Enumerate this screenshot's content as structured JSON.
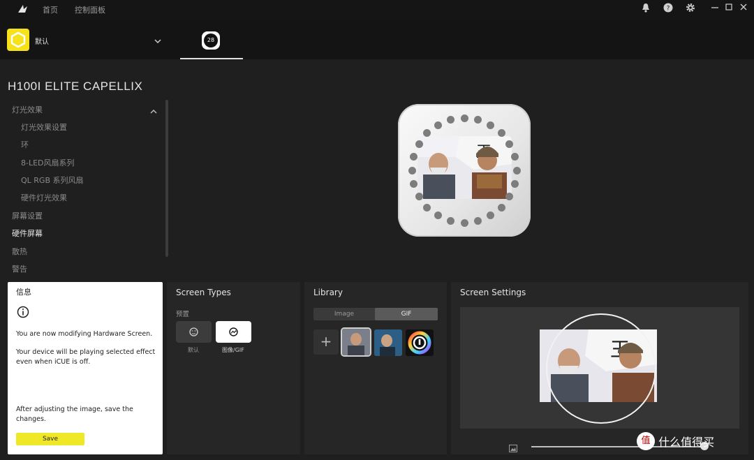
{
  "topbar": {
    "nav": [
      "首页",
      "控制面板"
    ],
    "icons": [
      "bell-icon",
      "help-icon",
      "gear-icon",
      "minimize-icon",
      "maximize-icon",
      "close-icon"
    ]
  },
  "profile": {
    "name": "默认"
  },
  "device_tab": {
    "value": "28"
  },
  "device": {
    "title": "H100I ELITE CAPELLIX"
  },
  "sidebar": {
    "items": [
      {
        "label": "灯光效果",
        "level": 0,
        "active": false,
        "expanded": true
      },
      {
        "label": "灯光效果设置",
        "level": 1
      },
      {
        "label": "环",
        "level": 1
      },
      {
        "label": "8-LED风扇系列",
        "level": 1
      },
      {
        "label": "QL RGB 系列风扇",
        "level": 1
      },
      {
        "label": "硬件灯光效果",
        "level": 1
      },
      {
        "label": "屏幕设置",
        "level": 0
      },
      {
        "label": "硬件屏幕",
        "level": 0,
        "active": true
      },
      {
        "label": "散热",
        "level": 0
      },
      {
        "label": "警告",
        "level": 0
      }
    ]
  },
  "info_panel": {
    "title": "信息",
    "line1": "You are now modifying Hardware Screen.",
    "line2": "Your device will be playing selected effect even when iCUE is off.",
    "line3": "After adjusting the image, save the changes.",
    "save_label": "Save"
  },
  "screen_types": {
    "title": "Screen Types",
    "group_label": "预置",
    "options": [
      {
        "label": "默认",
        "selected": false
      },
      {
        "label": "图像/GIF",
        "selected": true
      }
    ]
  },
  "library": {
    "title": "Library",
    "tabs": [
      {
        "label": "Image",
        "active": false
      },
      {
        "label": "GIF",
        "active": true
      }
    ],
    "add_label": "+"
  },
  "screen_settings": {
    "title": "Screen Settings",
    "zoom_fraction": 0.99
  },
  "watermark": {
    "text": "值 什么值得买"
  },
  "colors": {
    "accent": "#f5e21a",
    "save": "#efe826",
    "panel": "#262626",
    "bg": "#1f1f1f"
  }
}
